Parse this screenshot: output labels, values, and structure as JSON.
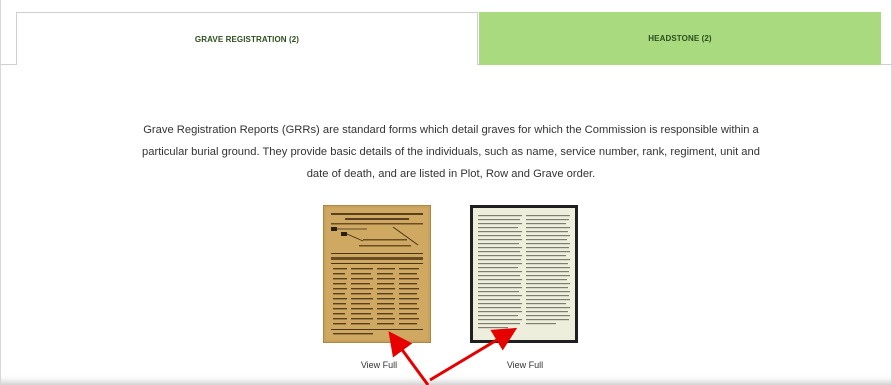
{
  "tabs": [
    {
      "label": "GRAVE REGISTRATION (2)",
      "active": true
    },
    {
      "label": "HEADSTONE (2)",
      "active": false
    }
  ],
  "description": "Grave Registration Reports (GRRs) are standard forms which detail graves for which the Commission is responsible within a particular burial ground. They provide basic details of the individuals, such as name, service number, rank, regiment, unit and date of death, and are listed in Plot, Row and Grave order.",
  "documents": [
    {
      "link_label": "View Full",
      "thumbnail": "yellowed-report-form"
    },
    {
      "link_label": "View Full",
      "thumbnail": "typed-page"
    }
  ],
  "colors": {
    "active_tab_bg": "#ffffff",
    "inactive_tab_bg": "#a9da80",
    "tab_text": "#2c4f1e",
    "annotation_arrow": "#e60000"
  },
  "annotations": [
    {
      "type": "arrow",
      "color": "#e60000",
      "points_to": "document-1-thumbnail"
    },
    {
      "type": "arrow",
      "color": "#e60000",
      "points_to": "document-2-thumbnail"
    }
  ]
}
